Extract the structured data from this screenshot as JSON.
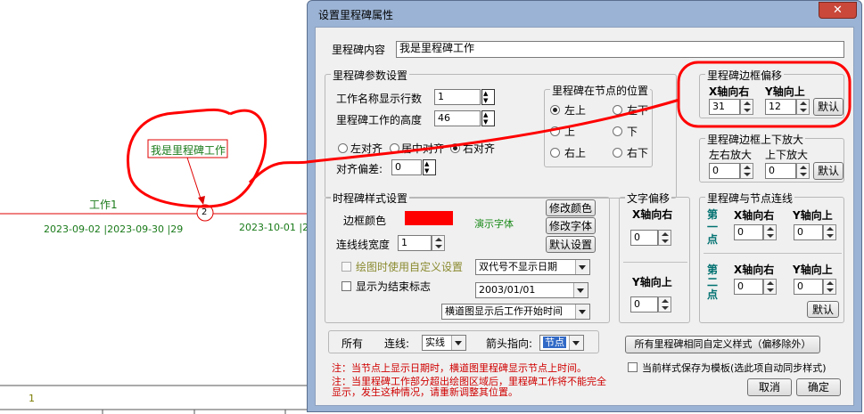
{
  "background": {
    "task_label": "工作1",
    "dates_left": "2023-09-02 |2023-09-30 |29",
    "dates_right": "2023-10-01 |20",
    "node_number": "2",
    "milestone_text": "我是里程碑工作",
    "row_number": "1"
  },
  "dialog": {
    "title": "设置里程碑属性",
    "close_label": "✕",
    "content_label": "里程碑内容",
    "content_value": "我是里程碑工作",
    "params": {
      "title": "里程碑参数设置",
      "rows_label": "工作名称显示行数",
      "rows_value": "1",
      "height_label": "里程碑工作的高度",
      "height_value": "46",
      "align_left": "左对齐",
      "align_center": "居中对齐",
      "align_right": "右对齐",
      "offset_label": "对齐偏差:",
      "offset_value": "0"
    },
    "position": {
      "title": "里程碑在节点的位置",
      "top_left": "左上",
      "bottom_left": "左下",
      "top": "上",
      "bottom": "下",
      "top_right": "右上",
      "bottom_right": "右下"
    },
    "border_offset": {
      "title": "里程碑边框偏移",
      "x_label": "X轴向右",
      "y_label": "Y轴向上",
      "x_value": "31",
      "y_value": "12",
      "default_label": "默认"
    },
    "border_scale": {
      "title": "里程碑边框上下放大",
      "lr_label": "左右放大",
      "ud_label": "上下放大",
      "lr_value": "0",
      "ud_value": "0",
      "default_label": "默认"
    },
    "style": {
      "title": "时程碑样式设置",
      "border_color_label": "边框颜色",
      "border_color": "#ff0000",
      "demo_font": "演示字体",
      "modify_color": "修改颜色",
      "modify_font": "修改字体",
      "default_settings": "默认设置",
      "line_width_label": "连线线宽度",
      "line_width_value": "1",
      "custom_when_draw": "绘图时使用自定义设置",
      "show_as_end": "显示为结束标志",
      "date_mode": "双代号不显示日期",
      "date_value": "2003/01/01",
      "gantt_mode": "横道图显示后工作开始时间"
    },
    "text_offset": {
      "title": "文字偏移",
      "x_label": "X轴向右",
      "x_value": "0",
      "y_label": "Y轴向上",
      "y_value": "0"
    },
    "node_link": {
      "title": "里程碑与节点连线",
      "first_point": "第一点",
      "second_point": "第二点",
      "x_label": "X轴向右",
      "y_label": "Y轴向上",
      "p1_x": "0",
      "p1_y": "0",
      "p2_x": "0",
      "p2_y": "0",
      "default_label": "默认"
    },
    "bottom": {
      "all_label": "所有",
      "line_label": "连线:",
      "line_value": "实线",
      "arrow_label": "箭头指向:",
      "arrow_value": "节点",
      "apply_all": "所有里程碑相同自定义样式（偏移除外）",
      "note1": "注：当节点上显示日期时，横道图里程碑显示节点上时间。",
      "note2": "注：当里程碑工作部分超出绘图区域后，里程碑工作将不能完全显示，发生这种情况，请重新调整其位置。",
      "save_template": "当前样式保存为模板(选此项自动同步样式)",
      "cancel": "取消",
      "ok": "确定"
    }
  }
}
